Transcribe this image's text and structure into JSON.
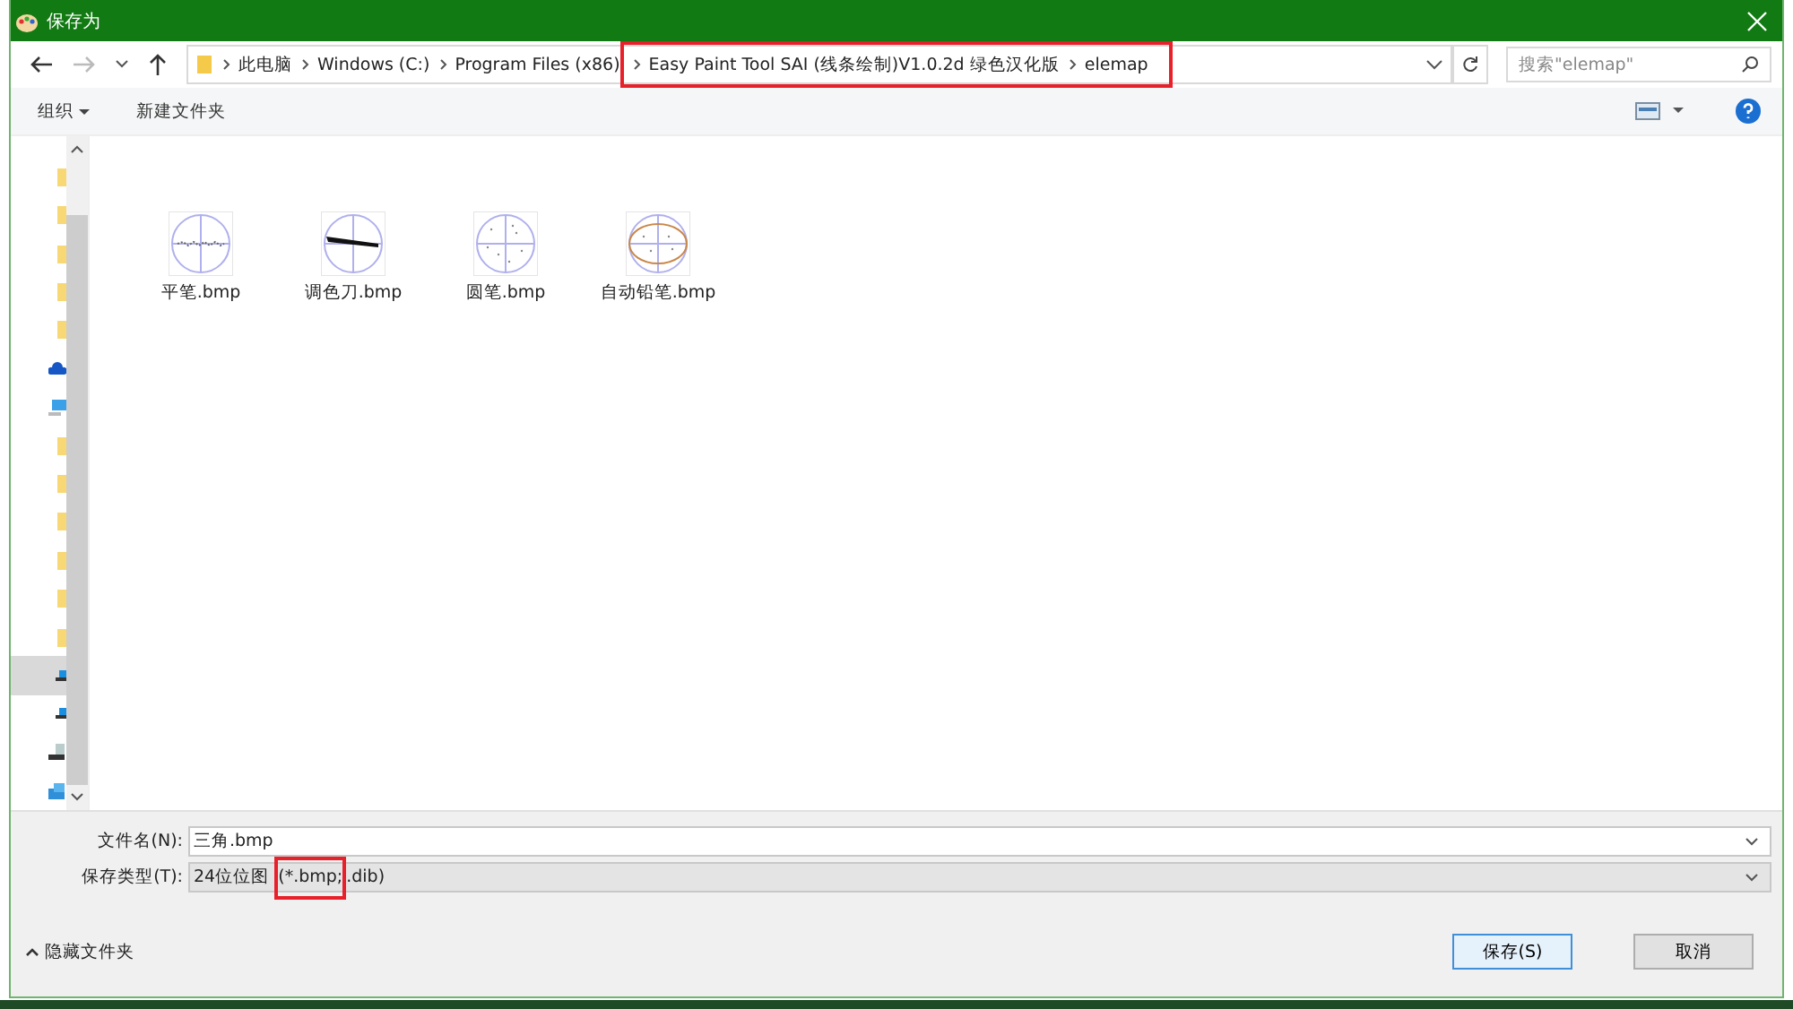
{
  "window": {
    "title": "保存为"
  },
  "address_bar": {
    "breadcrumbs": [
      {
        "label": "此电脑",
        "highlighted": false
      },
      {
        "label": "Windows (C:)",
        "highlighted": false
      },
      {
        "label": "Program Files (x86)",
        "highlighted": false
      },
      {
        "label": "Easy Paint Tool SAI (线条绘制)V1.0.2d 绿色汉化版",
        "highlighted": true
      },
      {
        "label": "elemap",
        "highlighted": true
      }
    ],
    "search": {
      "placeholder": "搜索\"elemap\""
    }
  },
  "toolbar": {
    "organize": "组织",
    "new_folder": "新建文件夹"
  },
  "nav_pane": [
    {
      "kind": "folder",
      "selected": false
    },
    {
      "kind": "folder",
      "selected": false
    },
    {
      "kind": "folder",
      "selected": false
    },
    {
      "kind": "folder",
      "selected": false
    },
    {
      "kind": "folder",
      "selected": false
    },
    {
      "kind": "cloud",
      "selected": false
    },
    {
      "kind": "computer",
      "selected": false
    },
    {
      "kind": "folder",
      "selected": false
    },
    {
      "kind": "folder",
      "selected": false
    },
    {
      "kind": "folder",
      "selected": false
    },
    {
      "kind": "folder",
      "selected": false
    },
    {
      "kind": "folder",
      "selected": false
    },
    {
      "kind": "folder",
      "selected": false
    },
    {
      "kind": "drive",
      "selected": true
    },
    {
      "kind": "drive",
      "selected": false
    },
    {
      "kind": "network-drive",
      "selected": false
    },
    {
      "kind": "network",
      "selected": false
    }
  ],
  "files": [
    {
      "name": "平笔.bmp",
      "kind": "line"
    },
    {
      "name": "调色刀.bmp",
      "kind": "knife"
    },
    {
      "name": "圆笔.bmp",
      "kind": "dots"
    },
    {
      "name": "自动铅笔.bmp",
      "kind": "ellipse"
    }
  ],
  "file_name": {
    "label": "文件名(N):",
    "value": "三角.bmp"
  },
  "save_type": {
    "label": "保存类型(T):",
    "segments": [
      {
        "text": "24位位图 ",
        "highlighted": false
      },
      {
        "text": "(*.bmp;",
        "highlighted": true
      },
      {
        "text": ".dib)",
        "highlighted": false
      }
    ]
  },
  "hide_folders": "隐藏文件夹",
  "buttons": [
    {
      "label": "保存(S)",
      "kind": "primary"
    },
    {
      "label": "取消",
      "kind": "secondary"
    }
  ]
}
